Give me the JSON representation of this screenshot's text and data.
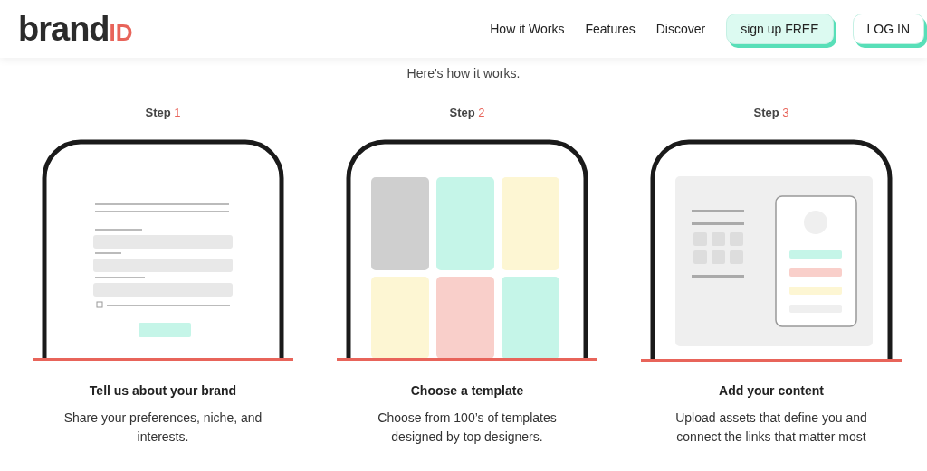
{
  "logo": {
    "text": "brand",
    "mark": "ID"
  },
  "nav": {
    "links": [
      "How it Works",
      "Features",
      "Discover"
    ],
    "signup": "sign up FREE",
    "login": "LOG IN"
  },
  "intro": "Here's how it works.",
  "steps": [
    {
      "label": "Step",
      "number": "1",
      "kind": "form",
      "title": "Tell us about your brand",
      "description": "Share your preferences, niche, and interests."
    },
    {
      "label": "Step",
      "number": "2",
      "kind": "templates",
      "title": "Choose a template",
      "description": "Choose from 100’s of templates designed by top designers."
    },
    {
      "label": "Step",
      "number": "3",
      "kind": "content",
      "title": "Add your content",
      "description": "Upload assets that define you and connect the links that matter most"
    }
  ]
}
